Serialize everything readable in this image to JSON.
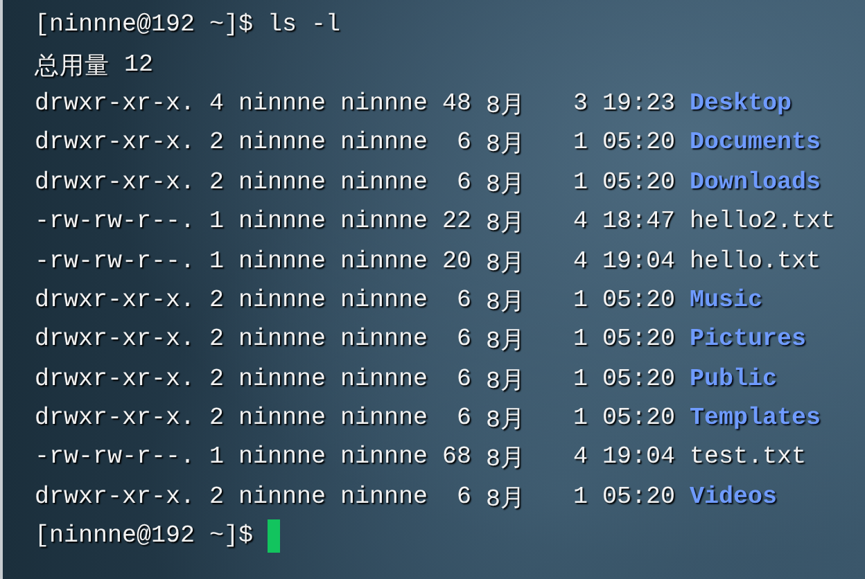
{
  "terminal": {
    "first_prompt": {
      "prompt": "[ninnne@192 ~]$",
      "command": "ls -l"
    },
    "total": {
      "label": "总用量",
      "value": "12"
    },
    "entries": [
      {
        "permissions": "drwxr-xr-x.",
        "links": "4",
        "owner": "ninnne",
        "group": "ninnne",
        "size": "48",
        "month": "8月",
        "day": "3",
        "time": "19:23",
        "name": "Desktop",
        "kind": "directory"
      },
      {
        "permissions": "drwxr-xr-x.",
        "links": "2",
        "owner": "ninnne",
        "group": "ninnne",
        "size": "6",
        "month": "8月",
        "day": "1",
        "time": "05:20",
        "name": "Documents",
        "kind": "directory"
      },
      {
        "permissions": "drwxr-xr-x.",
        "links": "2",
        "owner": "ninnne",
        "group": "ninnne",
        "size": "6",
        "month": "8月",
        "day": "1",
        "time": "05:20",
        "name": "Downloads",
        "kind": "directory"
      },
      {
        "permissions": "-rw-rw-r--.",
        "links": "1",
        "owner": "ninnne",
        "group": "ninnne",
        "size": "22",
        "month": "8月",
        "day": "4",
        "time": "18:47",
        "name": "hello2.txt",
        "kind": "file"
      },
      {
        "permissions": "-rw-rw-r--.",
        "links": "1",
        "owner": "ninnne",
        "group": "ninnne",
        "size": "20",
        "month": "8月",
        "day": "4",
        "time": "19:04",
        "name": "hello.txt",
        "kind": "file"
      },
      {
        "permissions": "drwxr-xr-x.",
        "links": "2",
        "owner": "ninnne",
        "group": "ninnne",
        "size": "6",
        "month": "8月",
        "day": "1",
        "time": "05:20",
        "name": "Music",
        "kind": "directory"
      },
      {
        "permissions": "drwxr-xr-x.",
        "links": "2",
        "owner": "ninnne",
        "group": "ninnne",
        "size": "6",
        "month": "8月",
        "day": "1",
        "time": "05:20",
        "name": "Pictures",
        "kind": "directory"
      },
      {
        "permissions": "drwxr-xr-x.",
        "links": "2",
        "owner": "ninnne",
        "group": "ninnne",
        "size": "6",
        "month": "8月",
        "day": "1",
        "time": "05:20",
        "name": "Public",
        "kind": "directory"
      },
      {
        "permissions": "drwxr-xr-x.",
        "links": "2",
        "owner": "ninnne",
        "group": "ninnne",
        "size": "6",
        "month": "8月",
        "day": "1",
        "time": "05:20",
        "name": "Templates",
        "kind": "directory"
      },
      {
        "permissions": "-rw-rw-r--.",
        "links": "1",
        "owner": "ninnne",
        "group": "ninnne",
        "size": "68",
        "month": "8月",
        "day": "4",
        "time": "19:04",
        "name": "test.txt",
        "kind": "file"
      },
      {
        "permissions": "drwxr-xr-x.",
        "links": "2",
        "owner": "ninnne",
        "group": "ninnne",
        "size": "6",
        "month": "8月",
        "day": "1",
        "time": "05:20",
        "name": "Videos",
        "kind": "directory"
      }
    ],
    "last_prompt": {
      "prompt": "[ninnne@192 ~]$",
      "cursor": true
    }
  }
}
